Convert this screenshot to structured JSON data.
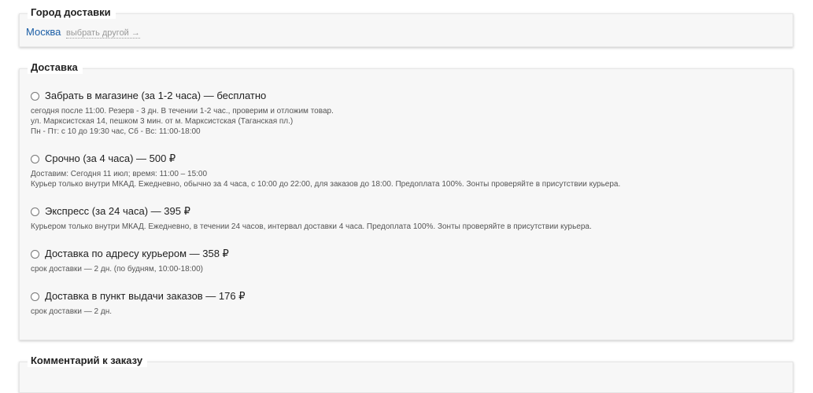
{
  "city": {
    "title": "Город доставки",
    "name": "Москва",
    "change_link": "выбрать другой →"
  },
  "delivery": {
    "title": "Доставка",
    "options": [
      {
        "label": "Забрать в магазине (за 1-2 часа) — бесплатно",
        "lines": [
          "сегодня после 11:00. Резерв - 3 дн. В течении 1-2 час., проверим и отложим товар.",
          "ул. Марксистская 14, пешком 3 мин. от м. Марксистская (Таганская пл.)",
          "Пн - Пт: с 10 до 19:30 час, Сб - Вс: 11:00-18:00"
        ]
      },
      {
        "label": "Срочно (за 4 часа) — 500 ₽",
        "lines": [
          "Доставим: Сегодня 11 июл; время: 11:00 – 15:00",
          "Курьер только внутри МКАД. Ежедневно, обычно за 4 часа, с 10:00 до 22:00, для заказов до 18:00. Предоплата 100%. Зонты проверяйте в присутствии курьера."
        ]
      },
      {
        "label": "Экспресс (за 24 часа) — 395 ₽",
        "lines": [
          "Курьером только внутри МКАД. Ежедневно, в течении 24 часов, интервал доставки 4 часа. Предоплата 100%. Зонты проверяйте в присутствии курьера."
        ]
      },
      {
        "label": "Доставка по адресу курьером — 358 ₽",
        "lines": [
          "срок доставки — 2 дн. (по будням, 10:00-18:00)"
        ]
      },
      {
        "label": "Доставка в пункт выдачи заказов — 176 ₽",
        "lines": [
          "срок доставки — 2 дн."
        ]
      }
    ]
  },
  "comment": {
    "title": "Комментарий к заказу"
  },
  "colors": {
    "link": "#1b5ea6",
    "muted": "#9a9a9a",
    "panel_bg": "#f7f7f7"
  }
}
